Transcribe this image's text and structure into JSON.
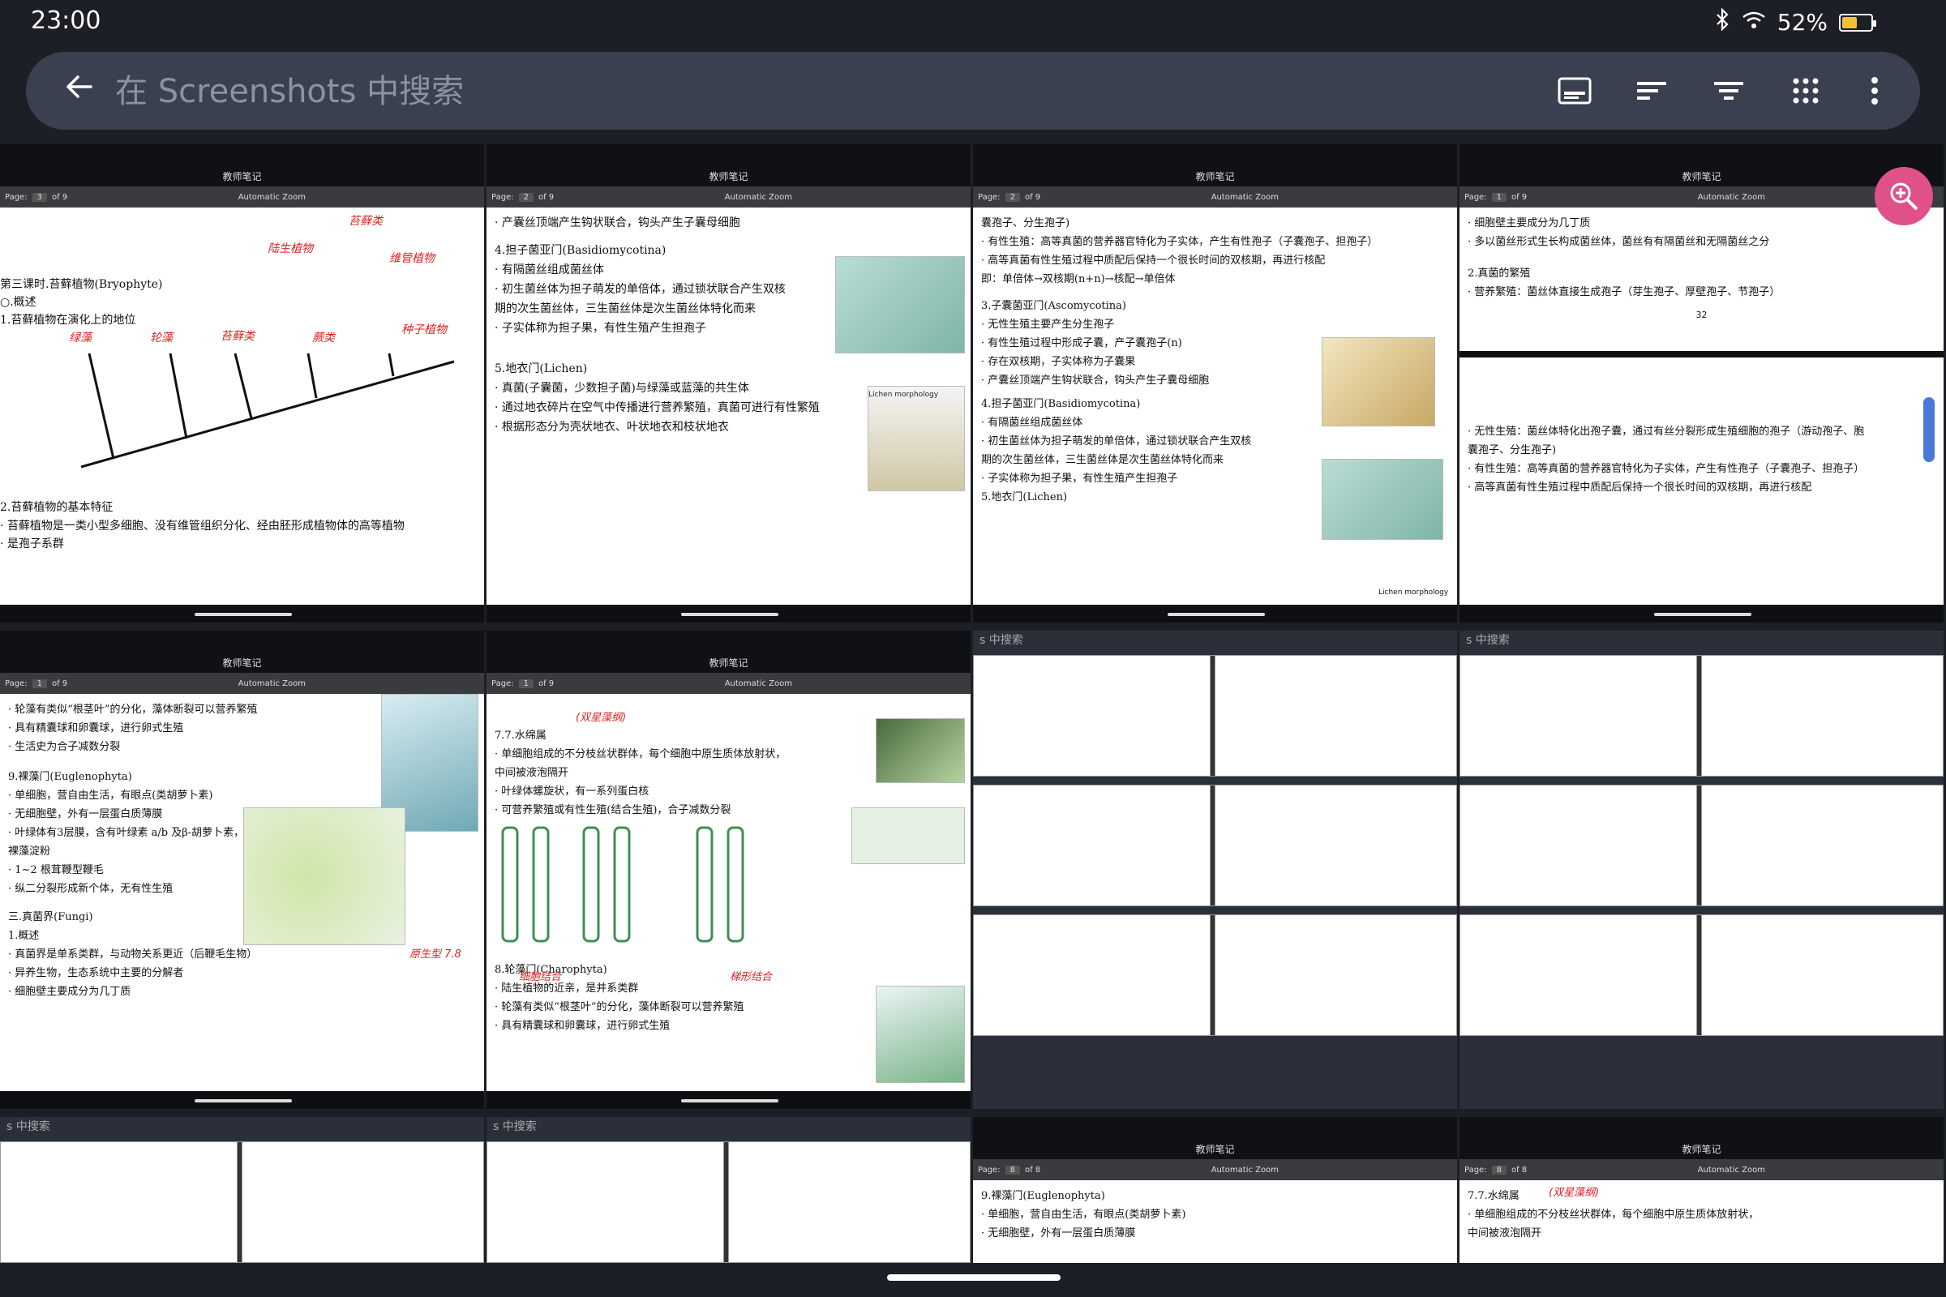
{
  "status": {
    "time": "23:00",
    "battery": "52%",
    "battery_fraction": 0.52
  },
  "search": {
    "placeholder": "在 Screenshots 中搜索"
  },
  "toolbar": {
    "icons": [
      "caption-icon",
      "sort-icon",
      "filter-icon",
      "grid-icon",
      "more-vert-icon"
    ]
  },
  "tiles": [
    {
      "header": "教师笔记",
      "page": "3",
      "of": "of 9",
      "zoom": "Automatic Zoom",
      "lines": [
        "第三课时.苔藓植物(Bryophyte)",
        "○.概述",
        "1.苔藓植物在演化上的地位",
        "2.苔藓植物的基本特征",
        "· 苔藓植物是一类小型多细胞、没有维管组织分化、经由胚形成植物体的高等植物",
        "· 是孢子系群"
      ],
      "notes": [
        "陆生植物",
        "苔藓类",
        "维管植物",
        "绿藻",
        "轮藻",
        "苔藓类",
        "蕨类",
        "种子植物"
      ]
    },
    {
      "header": "教师笔记",
      "page": "2",
      "of": "of 9",
      "zoom": "Automatic Zoom",
      "lines": [
        "· 产囊丝顶端产生钩状联合，钩头产生子囊母细胞",
        "4.担子菌亚门(Basidiomycotina)",
        "· 有隔菌丝组成菌丝体",
        "· 初生菌丝体为担子萌发的单倍体，通过锁状联合产生双核",
        "期的次生菌丝体，三生菌丝体是次生菌丝体特化而来",
        "· 子实体称为担子果，有性生殖产生担孢子",
        "5.地衣门(Lichen)",
        "· 真菌(子囊菌，少数担子菌)与绿藻或蓝藻的共生体",
        "· 通过地衣碎片在空气中传播进行营养繁殖，真菌可进行有性繁殖",
        "· 根据形态分为壳状地衣、叶状地衣和枝状地衣"
      ],
      "notes": [
        "Lichen morphology"
      ]
    },
    {
      "header": "教师笔记",
      "page": "2",
      "of": "of 9",
      "zoom": "Automatic Zoom",
      "lines": [
        "囊孢子、分生孢子)",
        "· 有性生殖：高等真菌的营养器官特化为子实体，产生有性孢子（子囊孢子、担孢子）",
        "· 高等真菌有性生殖过程中质配后保持一个很长时间的双核期，再进行核配",
        "即：单倍体→双核期(n+n)→核配→单倍体",
        "3.子囊菌亚门(Ascomycotina)",
        "· 无性生殖主要产生分生孢子",
        "· 有性生殖过程中形成子囊，产子囊孢子(n)",
        "· 存在双核期，子实体称为子囊果",
        "· 产囊丝顶端产生钩状联合，钩头产生子囊母细胞",
        "4.担子菌亚门(Basidiomycotina)",
        "· 有隔菌丝组成菌丝体",
        "· 初生菌丝体为担子萌发的单倍体，通过锁状联合产生双核",
        "期的次生菌丝体，三生菌丝体是次生菌丝体特化而来",
        "· 子实体称为担子果，有性生殖产生担孢子",
        "5.地衣门(Lichen)"
      ],
      "notes": [
        "Lichen morphology"
      ]
    },
    {
      "header": "教师笔记",
      "page": "1",
      "of": "of 9",
      "zoom": "Automatic Zoom",
      "lines": [
        "· 细胞壁主要成分为几丁质",
        "· 多以菌丝形式生长构成菌丝体，菌丝有有隔菌丝和无隔菌丝之分",
        "2.真菌的繁殖",
        "· 营养繁殖：菌丝体直接生成孢子（芽生孢子、厚壁孢子、节孢子）",
        "32",
        "· 无性生殖：菌丝体特化出孢子囊，通过有丝分裂形成生殖细胞的孢子（游动孢子、胞",
        "囊孢子、分生孢子)",
        "· 有性生殖：高等真菌的营养器官特化为子实体，产生有性孢子（子囊孢子、担孢子）",
        "· 高等真菌有性生殖过程中质配后保持一个很长时间的双核期，再进行核配"
      ],
      "notes": []
    },
    {
      "header": "教师笔记",
      "page": "1",
      "of": "of 9",
      "zoom": "Automatic Zoom",
      "lines": [
        "· 轮藻有类似“根茎叶”的分化，藻体断裂可以营养繁殖",
        "· 具有精囊球和卵囊球，进行卵式生殖",
        "· 生活史为合子减数分裂",
        "9.裸藻门(Euglenophyta)",
        "· 单细胞，营自由生活，有眼点(类胡萝卜素)",
        "· 无细胞壁，外有一层蛋白质薄膜",
        "· 叶绿体有3层膜，含有叶绿素 a/b 及β-胡萝卜素，光合产物为",
        "裸藻淀粉",
        "· 1~2 根茸鞭型鞭毛",
        "· 纵二分裂形成新个体，无有性生殖",
        "三.真菌界(Fungi)",
        "1.概述",
        "· 真菌界是单系类群，与动物关系更近（后鞭毛生物）",
        "· 异养生物，生态系统中主要的分解者",
        "· 细胞壁主要成分为几丁质"
      ],
      "notes": [
        "原生型 7.8"
      ]
    },
    {
      "header": "教师笔记",
      "page": "1",
      "of": "of 9",
      "zoom": "Automatic Zoom",
      "lines": [
        "7.7.水绵属",
        "· 单细胞组成的不分枝丝状群体，每个细胞中原生质体放射状，",
        "中间被液泡隔开",
        "· 叶绿体螺旋状，有一系列蛋白核",
        "· 可营养繁殖或有性生殖(结合生殖)，合子减数分裂",
        "8.轮藻门(Charophyta)",
        "· 陆生植物的近亲，是并系类群",
        "· 轮藻有类似“根茎叶”的分化，藻体断裂可以营养繁殖",
        "· 具有精囊球和卵囊球，进行卵式生殖"
      ],
      "notes": [
        "(双星藻纲)",
        "细胞结合",
        "梯形结合"
      ]
    }
  ],
  "mini_tiles": [
    {
      "label": "s 中搜索"
    },
    {
      "label": "s 中搜索"
    },
    {
      "label": "s 中搜索"
    },
    {
      "label": "s 中搜索"
    }
  ],
  "bottom_tiles": [
    {
      "header": "教师笔记",
      "page": "8",
      "of": "of 8",
      "zoom": "Automatic Zoom",
      "lines": [
        "9.裸藻门(Euglenophyta)",
        "· 单细胞，营自由生活，有眼点(类胡萝卜素)",
        "· 无细胞壁，外有一层蛋白质薄膜"
      ]
    },
    {
      "header": "教师笔记",
      "page": "8",
      "of": "of 8",
      "zoom": "Automatic Zoom",
      "lines": [
        "7.7.水绵属",
        "· 单细胞组成的不分枝丝状群体，每个细胞中原生质体放射状，",
        "中间被液泡隔开"
      ],
      "notes": [
        "(双星藻纲)"
      ]
    }
  ]
}
